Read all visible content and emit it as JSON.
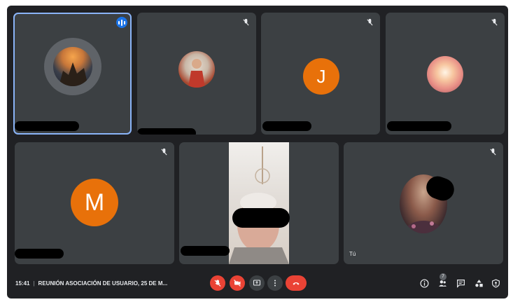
{
  "meeting": {
    "time": "15:41",
    "separator": "|",
    "title": "REUNIÓN ASOCIACIÓN DE USUARIO, 25 DE M..."
  },
  "participants": [
    {
      "id": "p1",
      "avatar": "photo-avatar-sunset",
      "state": "speaking",
      "name_visible": false
    },
    {
      "id": "p2",
      "avatar": "photo-avatar-person",
      "state": "muted",
      "name_visible": false
    },
    {
      "id": "p3",
      "avatar": "letter-avatar",
      "initial": "J",
      "state": "muted",
      "name_visible": false
    },
    {
      "id": "p4",
      "avatar": "photo-avatar-flowers",
      "state": "muted",
      "name_visible": false
    },
    {
      "id": "p5",
      "avatar": "letter-avatar",
      "initial": "M",
      "state": "muted",
      "name_visible": false
    },
    {
      "id": "p6",
      "avatar": "camera-video",
      "state": "active",
      "name_visible": false
    },
    {
      "id": "p7",
      "avatar": "photo-avatar-woman",
      "state": "muted",
      "self_label": "Tú"
    }
  ],
  "people_count": "7",
  "icons": {
    "muted": "mic-off-icon",
    "speaking": "audio-wave-icon",
    "mic": "mic-off-icon",
    "camera": "camera-off-icon",
    "present": "present-screen-icon",
    "more": "more-vert-icon",
    "hangup": "call-end-icon",
    "info": "info-icon",
    "people": "people-icon",
    "chat": "chat-icon",
    "activities": "activities-icon",
    "host": "host-controls-icon"
  },
  "colors": {
    "background": "#202124",
    "tile": "#3c4043",
    "speaking_outline": "#8ab4f8",
    "letter_avatar": "#e8710a",
    "danger": "#ea4335"
  }
}
